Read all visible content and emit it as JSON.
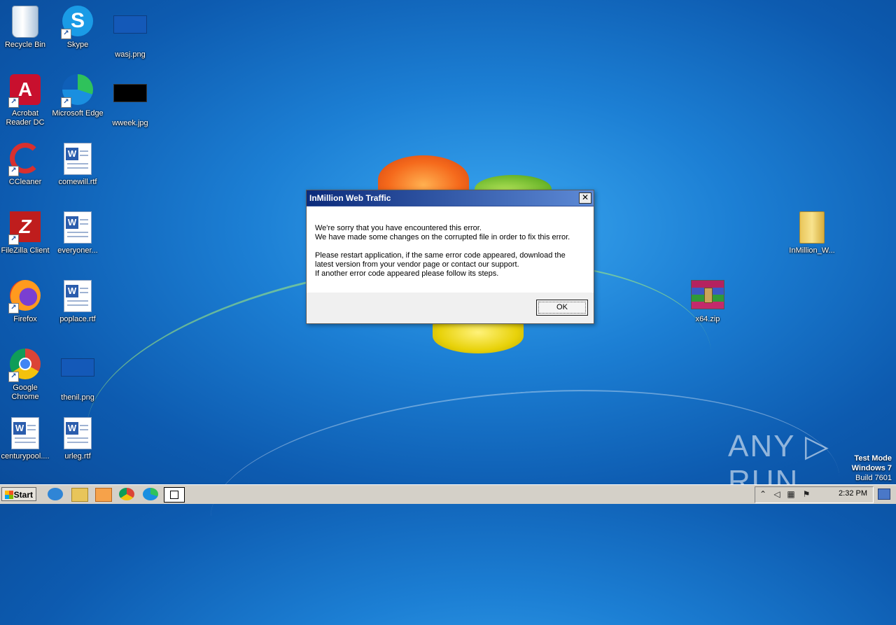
{
  "desktop": {
    "icons": [
      {
        "label": "Recycle Bin"
      },
      {
        "label": "Skype"
      },
      {
        "label": "wasj.png"
      },
      {
        "label": "Acrobat Reader DC"
      },
      {
        "label": "Microsoft Edge"
      },
      {
        "label": "wweek.jpg"
      },
      {
        "label": "CCleaner"
      },
      {
        "label": "comewill.rtf"
      },
      {
        "label": "FileZilla Client"
      },
      {
        "label": "everyoner..."
      },
      {
        "label": "Firefox"
      },
      {
        "label": "poplace.rtf"
      },
      {
        "label": "Google Chrome"
      },
      {
        "label": "thenil.png"
      },
      {
        "label": "centurypool...."
      },
      {
        "label": "urleg.rtf"
      },
      {
        "label": "InMillion_W..."
      },
      {
        "label": "x64.zip"
      }
    ]
  },
  "dialog": {
    "title": "InMillion Web Traffic",
    "close_label": "✕",
    "paragraph1_line1": "We're sorry that you have encountered this error.",
    "paragraph1_line2": "We have made some changes on the corrupted file in order to fix this error.",
    "paragraph2_line1": "Please restart application, if the same error code appeared, download the",
    "paragraph2_line2": "latest version from your vendor page or contact our support.",
    "paragraph2_line3": "If another error code appeared please follow its steps.",
    "ok_label": "OK"
  },
  "watermark": {
    "brand": "ANY ▷ RUN",
    "test_mode": "Test Mode",
    "os": "Windows 7",
    "build": "Build 7601"
  },
  "taskbar": {
    "start_label": "Start",
    "clock": "2:32 PM"
  },
  "colors": {
    "title_bar_start": "#0b2a7a",
    "title_bar_end": "#5d8ad6",
    "desktop_bg": "#1c7fd4",
    "taskbar_bg": "#d4d0c8"
  }
}
